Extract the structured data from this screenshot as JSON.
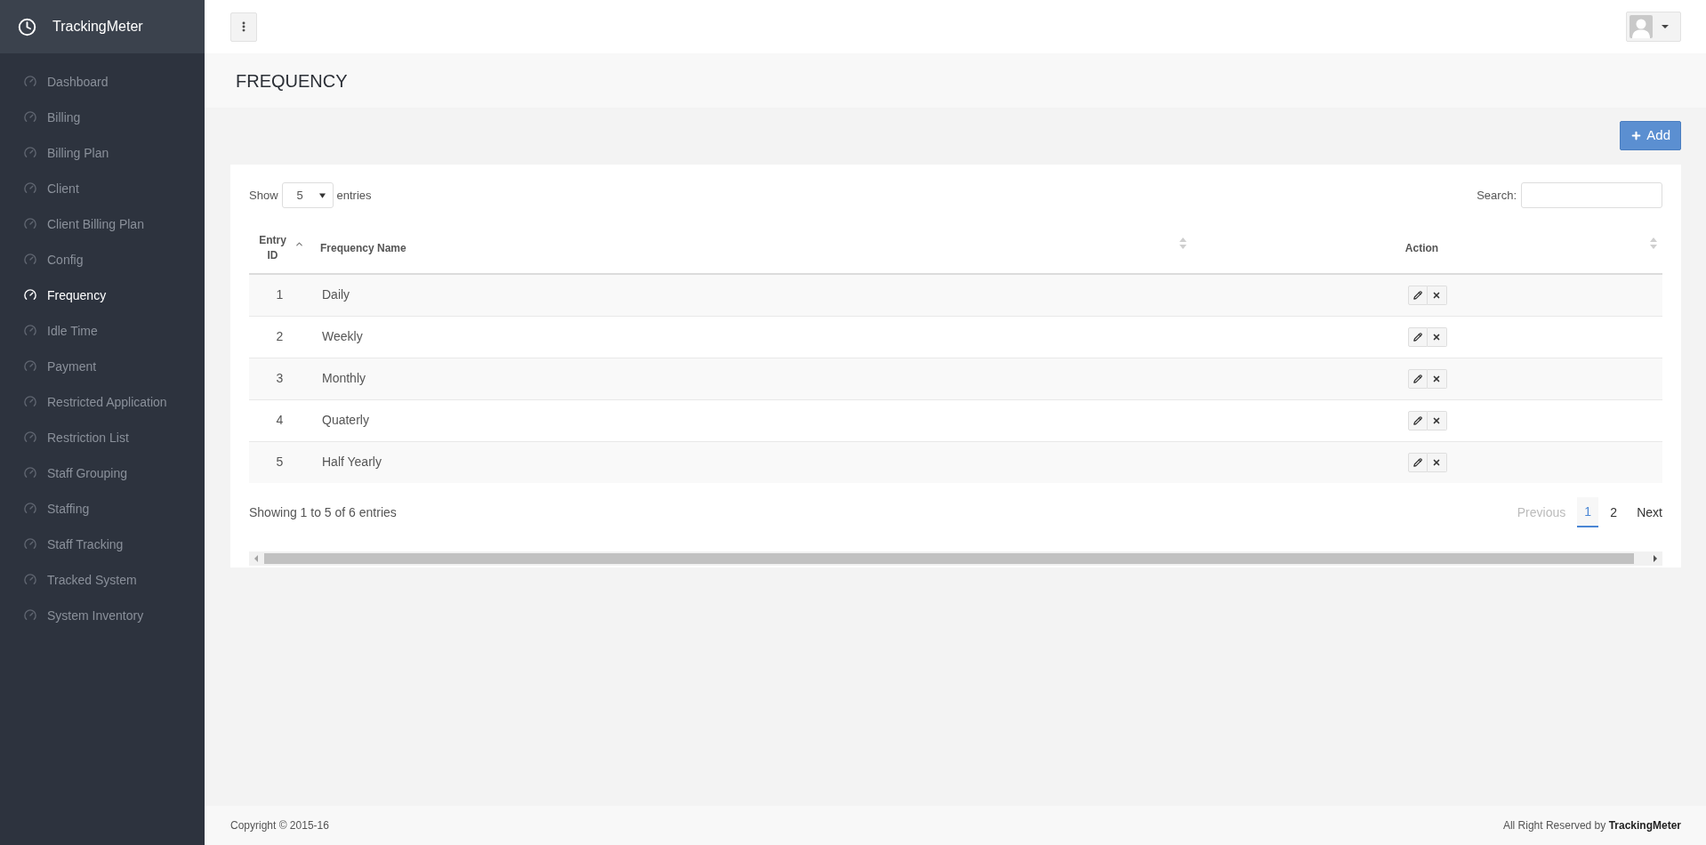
{
  "app": {
    "title": "TrackingMeter"
  },
  "sidebar": {
    "items": [
      {
        "label": "Dashboard",
        "selected": false
      },
      {
        "label": "Billing",
        "selected": false
      },
      {
        "label": "Billing Plan",
        "selected": false
      },
      {
        "label": "Client",
        "selected": false
      },
      {
        "label": "Client Billing Plan",
        "selected": false
      },
      {
        "label": "Config",
        "selected": false
      },
      {
        "label": "Frequency",
        "selected": true
      },
      {
        "label": "Idle Time",
        "selected": false
      },
      {
        "label": "Payment",
        "selected": false
      },
      {
        "label": "Restricted Application",
        "selected": false
      },
      {
        "label": "Restriction List",
        "selected": false
      },
      {
        "label": "Staff Grouping",
        "selected": false
      },
      {
        "label": "Staffing",
        "selected": false
      },
      {
        "label": "Staff Tracking",
        "selected": false
      },
      {
        "label": "Tracked System",
        "selected": false
      },
      {
        "label": "System Inventory",
        "selected": false
      }
    ]
  },
  "page": {
    "title": "FREQUENCY",
    "add_button": "Add"
  },
  "table_controls": {
    "show_label": "Show",
    "page_size": "5",
    "entries_label": "entries",
    "search_label": "Search:"
  },
  "table": {
    "columns": [
      {
        "label": "Entry ID",
        "sorted": true
      },
      {
        "label": "Frequency Name",
        "sorted": false
      },
      {
        "label": "Action",
        "sorted": false
      }
    ],
    "rows": [
      {
        "id": "1",
        "name": "Daily"
      },
      {
        "id": "2",
        "name": "Weekly"
      },
      {
        "id": "3",
        "name": "Monthly"
      },
      {
        "id": "4",
        "name": "Quaterly"
      },
      {
        "id": "5",
        "name": "Half Yearly"
      }
    ]
  },
  "info": "Showing 1 to 5 of 6 entries",
  "pagination": {
    "previous": {
      "label": "Previous",
      "disabled": true
    },
    "pages": [
      {
        "label": "1",
        "selected": true
      },
      {
        "label": "2",
        "selected": false
      }
    ],
    "next": {
      "label": "Next",
      "disabled": false
    }
  },
  "footer": {
    "copyright": "Copyright © 2015-16",
    "credit": "All Right Reserved by **TrackingMeter**"
  }
}
